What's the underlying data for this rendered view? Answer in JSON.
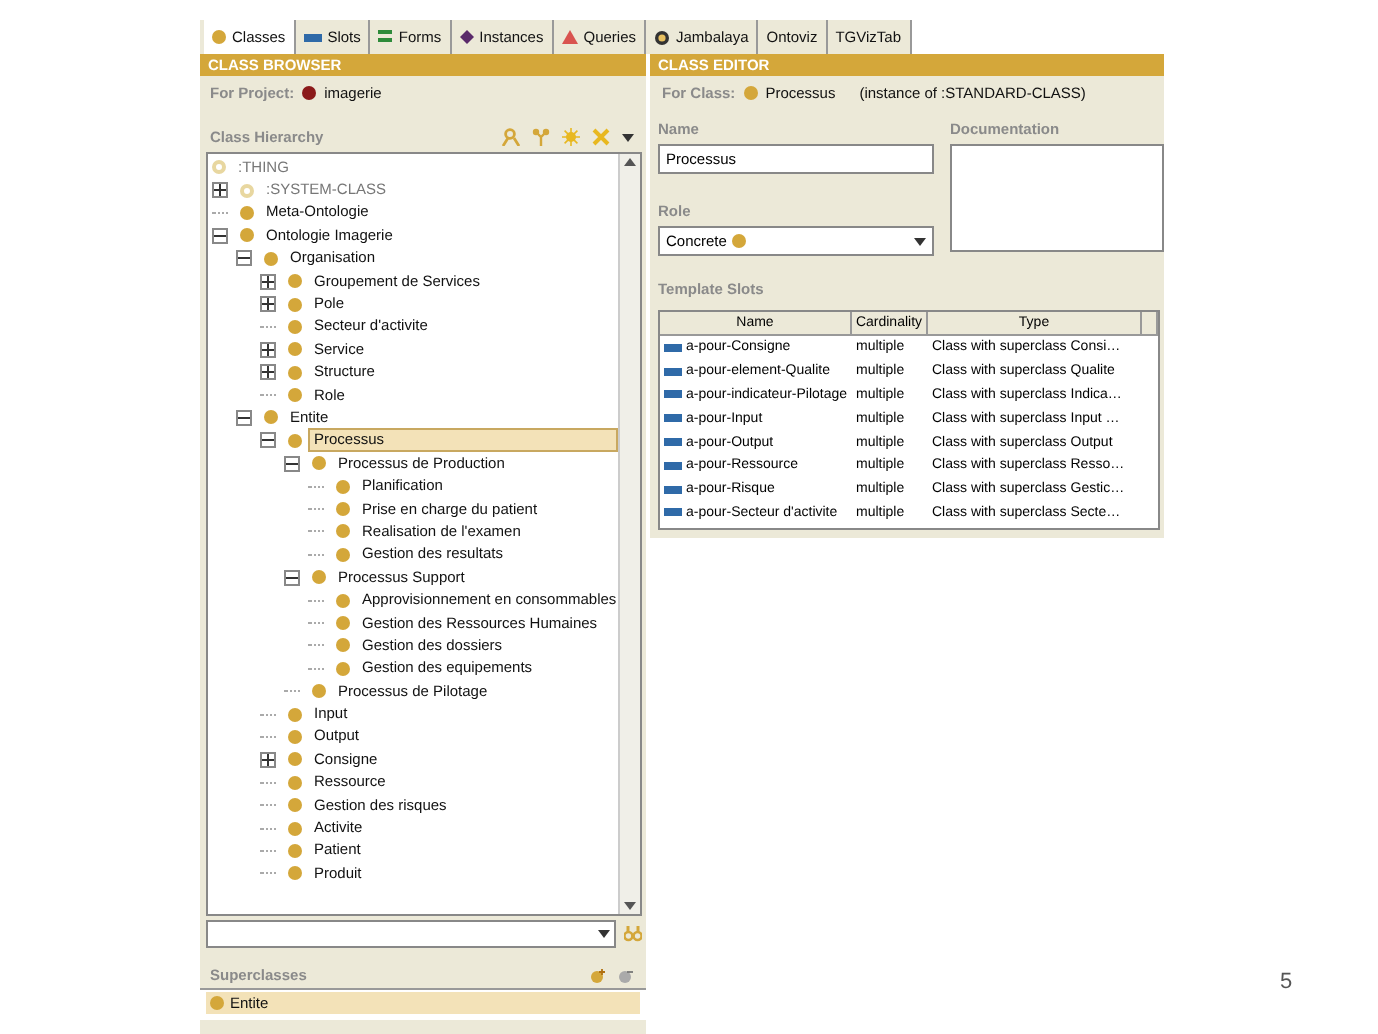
{
  "tabs": [
    {
      "label": "Classes",
      "kind": "classes",
      "selected": true
    },
    {
      "label": "Slots",
      "kind": "slots",
      "selected": false
    },
    {
      "label": "Forms",
      "kind": "forms",
      "selected": false
    },
    {
      "label": "Instances",
      "kind": "instances",
      "selected": false
    },
    {
      "label": "Queries",
      "kind": "queries",
      "selected": false
    },
    {
      "label": "Jambalaya",
      "kind": "jambalaya",
      "selected": false
    },
    {
      "label": "Ontoviz",
      "kind": "plain",
      "selected": false
    },
    {
      "label": "TGVizTab",
      "kind": "plain",
      "selected": false
    }
  ],
  "class_browser": {
    "title": "CLASS BROWSER",
    "project_label": "For Project:",
    "project": "imagerie",
    "hierarchy_label": "Class Hierarchy",
    "tree": [
      {
        "label": ":THING",
        "kind": "system",
        "selected": false,
        "children": [
          {
            "label": ":SYSTEM-CLASS",
            "kind": "system",
            "selected": false,
            "expanded": false
          },
          {
            "label": "Meta-Ontologie",
            "kind": "class",
            "selected": false
          },
          {
            "label": "Ontologie Imagerie",
            "kind": "class",
            "selected": false,
            "expanded": true,
            "children": [
              {
                "label": "Organisation",
                "kind": "class",
                "selected": false,
                "expanded": true,
                "children": [
                  {
                    "label": "Groupement de Services",
                    "kind": "class",
                    "selected": false,
                    "expanded": false
                  },
                  {
                    "label": "Pole",
                    "kind": "class",
                    "selected": false,
                    "expanded": false
                  },
                  {
                    "label": "Secteur d'activite",
                    "kind": "class",
                    "selected": false
                  },
                  {
                    "label": "Service",
                    "kind": "class",
                    "selected": false,
                    "expanded": false
                  },
                  {
                    "label": "Structure",
                    "kind": "class",
                    "selected": false,
                    "expanded": false
                  },
                  {
                    "label": "Role",
                    "kind": "class",
                    "selected": false
                  }
                ]
              },
              {
                "label": "Entite",
                "kind": "class",
                "selected": false,
                "expanded": true,
                "children": [
                  {
                    "label": "Processus",
                    "kind": "class",
                    "selected": true,
                    "expanded": true,
                    "children": [
                      {
                        "label": "Processus de Production",
                        "kind": "class",
                        "selected": false,
                        "expanded": true,
                        "children": [
                          {
                            "label": "Planification",
                            "kind": "class",
                            "selected": false
                          },
                          {
                            "label": "Prise en charge du patient",
                            "kind": "class",
                            "selected": false
                          },
                          {
                            "label": "Realisation de l'examen",
                            "kind": "class",
                            "selected": false
                          },
                          {
                            "label": "Gestion des resultats",
                            "kind": "class",
                            "selected": false
                          }
                        ]
                      },
                      {
                        "label": "Processus Support",
                        "kind": "class",
                        "selected": false,
                        "expanded": true,
                        "children": [
                          {
                            "label": "Approvisionnement en consommables",
                            "kind": "class",
                            "selected": false
                          },
                          {
                            "label": "Gestion des Ressources Humaines",
                            "kind": "class",
                            "selected": false
                          },
                          {
                            "label": "Gestion des dossiers",
                            "kind": "class",
                            "selected": false
                          },
                          {
                            "label": "Gestion des equipements",
                            "kind": "class",
                            "selected": false
                          }
                        ]
                      },
                      {
                        "label": "Processus de Pilotage",
                        "kind": "class",
                        "selected": false
                      }
                    ]
                  },
                  {
                    "label": "Input",
                    "kind": "class",
                    "selected": false
                  },
                  {
                    "label": "Output",
                    "kind": "class",
                    "selected": false
                  },
                  {
                    "label": "Consigne",
                    "kind": "class",
                    "selected": false,
                    "expanded": false
                  },
                  {
                    "label": "Ressource",
                    "kind": "class",
                    "selected": false
                  },
                  {
                    "label": "Gestion des risques",
                    "kind": "class",
                    "selected": false
                  },
                  {
                    "label": "Activite",
                    "kind": "class",
                    "selected": false
                  },
                  {
                    "label": "Patient",
                    "kind": "class",
                    "selected": false
                  },
                  {
                    "label": "Produit",
                    "kind": "class",
                    "selected": false
                  }
                ]
              }
            ]
          }
        ]
      }
    ],
    "superclasses_label": "Superclasses",
    "superclasses": [
      {
        "label": "Entite",
        "selected": true
      }
    ]
  },
  "class_editor": {
    "title": "CLASS EDITOR",
    "class_label": "For Class:",
    "class_name": "Processus",
    "instance_of": "(instance of :STANDARD-CLASS)",
    "name_label": "Name",
    "name_value": "Processus",
    "documentation_label": "Documentation",
    "role_label": "Role",
    "role_value": "Concrete",
    "slots_label": "Template Slots",
    "columns": [
      "Name",
      "Cardinality",
      "Type"
    ],
    "rows": [
      {
        "name": "a-pour-Consigne",
        "cardinality": "multiple",
        "type": "Class with superclass Consi…"
      },
      {
        "name": "a-pour-element-Qualite",
        "cardinality": "multiple",
        "type": "Class with superclass Qualite"
      },
      {
        "name": "a-pour-indicateur-Pilotage",
        "cardinality": "multiple",
        "type": "Class with superclass Indica…"
      },
      {
        "name": "a-pour-Input",
        "cardinality": "multiple",
        "type": "Class with superclass Input …"
      },
      {
        "name": "a-pour-Output",
        "cardinality": "multiple",
        "type": "Class with superclass Output"
      },
      {
        "name": "a-pour-Ressource",
        "cardinality": "multiple",
        "type": "Class with superclass Resso…"
      },
      {
        "name": "a-pour-Risque",
        "cardinality": "multiple",
        "type": "Class with superclass Gestic…"
      },
      {
        "name": "a-pour-Secteur d'activite",
        "cardinality": "multiple",
        "type": "Class with superclass Secte…"
      }
    ]
  },
  "page_number": "5"
}
